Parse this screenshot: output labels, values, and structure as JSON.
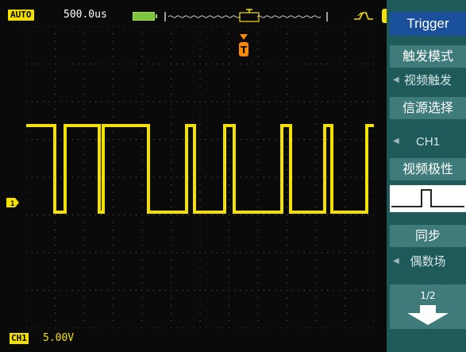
{
  "status": {
    "mode": "AUTO",
    "timebase": "500.0us",
    "channel_badge": "CH1",
    "volts_div": "5.00V"
  },
  "markers": {
    "channel": "1",
    "trigger": "T"
  },
  "menu": {
    "title": "Trigger",
    "trigger_mode_label": "触发模式",
    "trigger_mode_value": "视频触发",
    "source_label": "信源选择",
    "source_value": "CH1",
    "polarity_label": "视频极性",
    "sync_label": "同步",
    "sync_value": "偶数场",
    "page": "1/2"
  },
  "colors": {
    "trace": "#f4e000",
    "menu_bg": "#1f5a5a",
    "menu_item": "#3f7b7b",
    "title_bg": "#1a4f9c",
    "trigger_marker": "#ff8a00"
  },
  "icons": {
    "battery": "battery-icon",
    "slope": "rising-edge-icon",
    "next_page": "arrow-down-icon"
  }
}
